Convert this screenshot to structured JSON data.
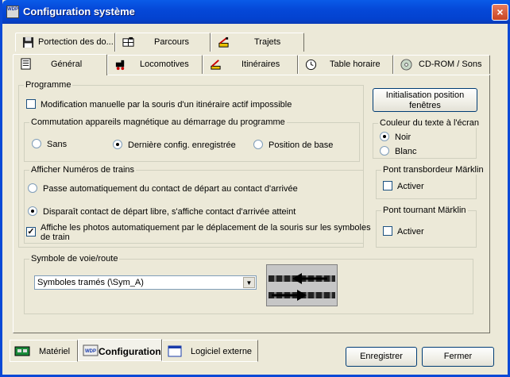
{
  "window": {
    "title": "Configuration système",
    "close_glyph": "×",
    "icon_text": "WDP"
  },
  "tabs_back": [
    {
      "label": "Portection des do...",
      "icon": "floppy-disk-icon"
    },
    {
      "label": "Parcours",
      "icon": "route-grid-icon"
    },
    {
      "label": "Trajets",
      "icon": "trajets-signal-icon"
    }
  ],
  "tabs_front": [
    {
      "label": "Général",
      "icon": "document-list-icon",
      "active": true
    },
    {
      "label": "Locomotives",
      "icon": "locomotive-icon"
    },
    {
      "label": "Itinéraires",
      "icon": "itinerary-signal-icon"
    },
    {
      "label": "Table horaire",
      "icon": "clock-icon"
    },
    {
      "label": "CD-ROM / Sons",
      "icon": "cd-icon"
    }
  ],
  "programme": {
    "title": "Programme",
    "manual_modify_label": "Modification manuelle par la souris d'un itinéraire actif impossible",
    "manual_modify_checked": false
  },
  "init_button": {
    "line1": "Initialisation position",
    "line2": "fenêtres"
  },
  "commutation": {
    "title": "Commutation appareils magnétique au démarrage du programme",
    "options": [
      {
        "label": "Sans",
        "selected": false
      },
      {
        "label": "Dernière config. enregistrée",
        "selected": true
      },
      {
        "label": "Position de base",
        "selected": false
      }
    ]
  },
  "text_color": {
    "title": "Couleur du texte à l'écran",
    "options": [
      {
        "label": "Noir",
        "selected": true
      },
      {
        "label": "Blanc",
        "selected": false
      }
    ]
  },
  "train_numbers": {
    "title": "Afficher Numéros de trains",
    "options": [
      {
        "label": "Passe automatiquement du contact de départ au contact d'arrivée",
        "selected": false
      },
      {
        "label": "Disparaît contact de départ libre, s'affiche contact d'arrivée atteint",
        "selected": true
      }
    ],
    "photos_label_1": "Affiche les photos automatiquement par le déplacement de la souris sur les symboles",
    "photos_label_2": "de train",
    "photos_checked": true
  },
  "pont_transbordeur": {
    "title": "Pont transbordeur Märklin",
    "activate_label": "Activer",
    "checked": false
  },
  "pont_tournant": {
    "title": "Pont tournant Märklin",
    "activate_label": "Activer",
    "checked": false
  },
  "symbole": {
    "title": "Symbole de voie/route",
    "selected_value": "Symboles tramés (\\Sym_A)"
  },
  "bottom_tabs": [
    {
      "label": "Matériel",
      "icon": "hardware-board-icon"
    },
    {
      "label": "Configuration",
      "icon": "wdp-logo-icon",
      "active": true
    },
    {
      "label": "Logiciel externe",
      "icon": "window-icon"
    }
  ],
  "footer": {
    "save_label": "Enregistrer",
    "close_label": "Fermer"
  }
}
